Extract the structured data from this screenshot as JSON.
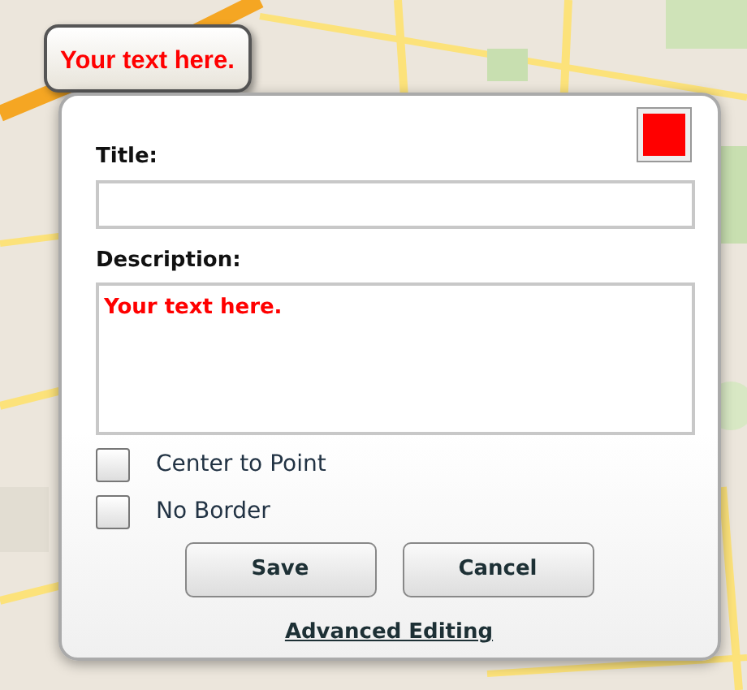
{
  "marker_label": {
    "text": "Your text here."
  },
  "editor": {
    "color_picker": {
      "color": "#ff0000"
    },
    "title": {
      "label": "Title:"
    },
    "description": {
      "label": "Description:",
      "value": "Your text here."
    },
    "options": [
      {
        "label": "Center to Point",
        "checked": false
      },
      {
        "label": "No Border",
        "checked": false
      }
    ],
    "buttons": [
      "Save",
      "Cancel"
    ],
    "link": "Advanced Editing"
  }
}
